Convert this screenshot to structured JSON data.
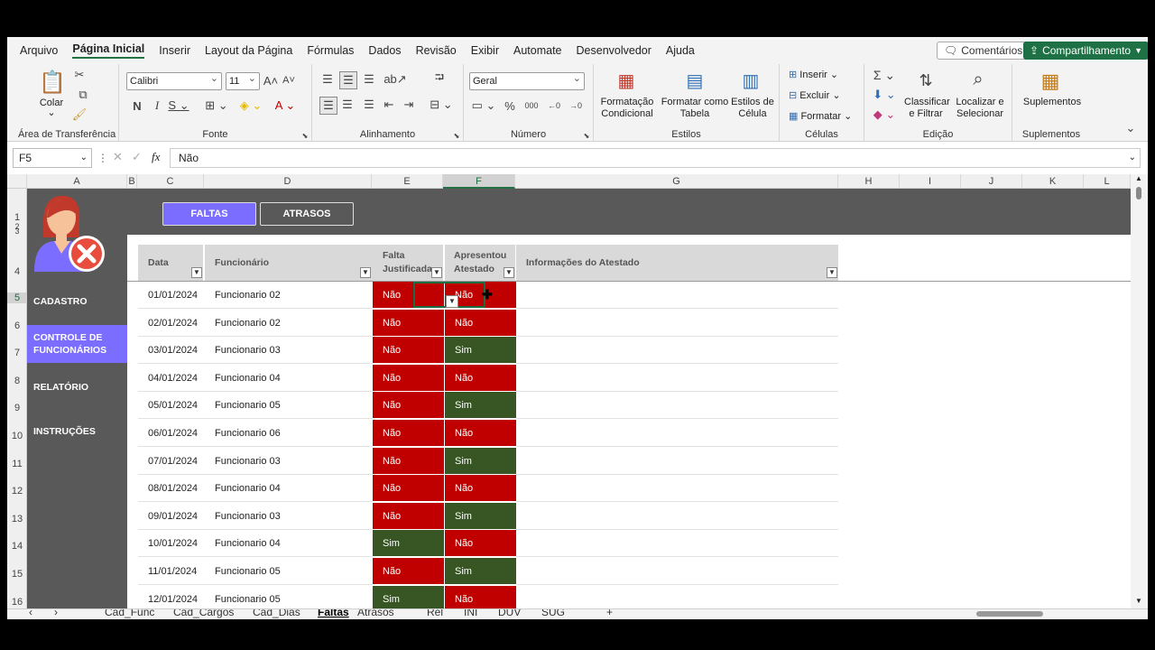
{
  "menu": [
    "Arquivo",
    "Página Inicial",
    "Inserir",
    "Layout da Página",
    "Fórmulas",
    "Dados",
    "Revisão",
    "Exibir",
    "Automate",
    "Desenvolvedor",
    "Ajuda"
  ],
  "menu_active": "Página Inicial",
  "top_buttons": {
    "comments": "Comentários",
    "share": "Compartilhamento"
  },
  "ribbon": {
    "clipboard": {
      "paste": "Colar",
      "label": "Área de Transferência"
    },
    "font": {
      "name": "Calibri",
      "size": "11",
      "label": "Fonte"
    },
    "alignment": {
      "label": "Alinhamento"
    },
    "number": {
      "format": "Geral",
      "label": "Número"
    },
    "styles": {
      "cond": "Formatação Condicional",
      "table": "Formatar como Tabela",
      "cell": "Estilos de Célula",
      "label": "Estilos"
    },
    "cells": {
      "insert": "Inserir",
      "delete": "Excluir",
      "format": "Formatar",
      "label": "Células"
    },
    "editing": {
      "sort": "Classificar e Filtrar",
      "find": "Localizar e Selecionar",
      "label": "Edição"
    },
    "addins": {
      "btn": "Suplementos",
      "label": "Suplementos"
    }
  },
  "formula_bar": {
    "name_box": "F5",
    "formula": "Não",
    "fx": "fx"
  },
  "columns": [
    "A",
    "B",
    "C",
    "D",
    "E",
    "F",
    "G",
    "H",
    "I",
    "J",
    "K",
    "L"
  ],
  "rows": [
    "1",
    "2",
    "3",
    "4",
    "5",
    "6",
    "7",
    "8",
    "9",
    "10",
    "11",
    "12",
    "13",
    "14",
    "15",
    "16"
  ],
  "sidebar": [
    "CADASTRO",
    "CONTROLE DE FUNCIONÁRIOS",
    "RELATÓRIO",
    "INSTRUÇÕES"
  ],
  "sidebar_active": "CONTROLE DE FUNCIONÁRIOS",
  "view_tabs": {
    "faltas": "FALTAS",
    "atrasos": "ATRASOS"
  },
  "table": {
    "headers": {
      "data": "Data",
      "funcionario": "Funcionário",
      "falta1": "Falta",
      "falta2": "Justificada",
      "apr1": "Apresentou",
      "apr2": "Atestado",
      "info": "Informações do Atestado"
    },
    "rows": [
      {
        "data": "01/01/2024",
        "func": "Funcionario 02",
        "falta": "Não",
        "atestado": "Não"
      },
      {
        "data": "02/01/2024",
        "func": "Funcionario 02",
        "falta": "Não",
        "atestado": "Não"
      },
      {
        "data": "03/01/2024",
        "func": "Funcionario 03",
        "falta": "Não",
        "atestado": "Sim"
      },
      {
        "data": "04/01/2024",
        "func": "Funcionario 04",
        "falta": "Não",
        "atestado": "Não"
      },
      {
        "data": "05/01/2024",
        "func": "Funcionario 05",
        "falta": "Não",
        "atestado": "Sim"
      },
      {
        "data": "06/01/2024",
        "func": "Funcionario 06",
        "falta": "Não",
        "atestado": "Não"
      },
      {
        "data": "07/01/2024",
        "func": "Funcionario 03",
        "falta": "Não",
        "atestado": "Sim"
      },
      {
        "data": "08/01/2024",
        "func": "Funcionario 04",
        "falta": "Não",
        "atestado": "Não"
      },
      {
        "data": "09/01/2024",
        "func": "Funcionario 03",
        "falta": "Não",
        "atestado": "Sim"
      },
      {
        "data": "10/01/2024",
        "func": "Funcionario 04",
        "falta": "Sim",
        "atestado": "Não"
      },
      {
        "data": "11/01/2024",
        "func": "Funcionario 05",
        "falta": "Não",
        "atestado": "Sim"
      },
      {
        "data": "12/01/2024",
        "func": "Funcionario 05",
        "falta": "Sim",
        "atestado": "Não"
      }
    ]
  },
  "sheet_tabs": [
    "Cad_Func",
    "Cad_Cargos",
    "Cad_Dias",
    "Faltas",
    "Atrasos",
    "Rel",
    "INI",
    "DUV",
    "SUG"
  ],
  "sheet_active": "Faltas",
  "colors": {
    "no": "#c00000",
    "yes": "#375623",
    "accent": "#7a6dff",
    "dark": "#595959"
  }
}
